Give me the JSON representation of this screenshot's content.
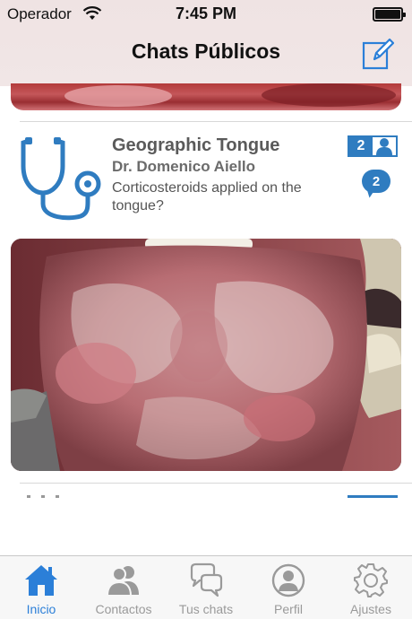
{
  "status_bar": {
    "carrier": "Operador",
    "time": "7:45 PM"
  },
  "nav": {
    "title": "Chats Públicos",
    "compose_icon": "compose-icon"
  },
  "chat_card": {
    "title": "Geographic Tongue",
    "doctor": "Dr. Domenico Aiello",
    "question": "Corticosteroids applied on the tongue?",
    "participants_count": "2",
    "messages_count": "2",
    "icon": "stethoscope-icon"
  },
  "tabs": [
    {
      "label": "Inicio",
      "icon": "home-icon",
      "active": true
    },
    {
      "label": "Contactos",
      "icon": "contacts-icon",
      "active": false
    },
    {
      "label": "Tus chats",
      "icon": "chat-bubbles-icon",
      "active": false
    },
    {
      "label": "Perfil",
      "icon": "profile-icon",
      "active": false
    },
    {
      "label": "Ajustes",
      "icon": "settings-icon",
      "active": false
    }
  ],
  "colors": {
    "accent": "#2f7cc0",
    "tab_active": "#2b7fd8",
    "tab_inactive": "#9a9a9a",
    "title_gray": "#5a5a5a"
  }
}
